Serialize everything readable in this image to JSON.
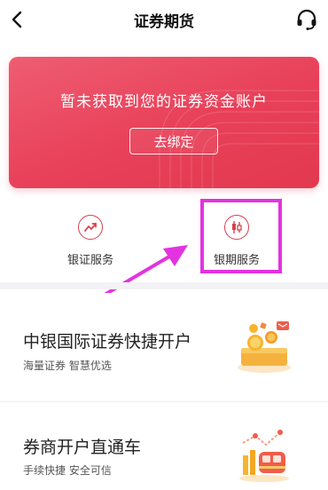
{
  "header": {
    "title": "证券期货",
    "back_icon": "chevron-left-icon",
    "support_icon": "headset-icon"
  },
  "banner": {
    "message": "暂未获取到您的证券资金账户",
    "bind_button": "去绑定",
    "color": "#e84059"
  },
  "services": [
    {
      "label": "银证服务",
      "icon": "trend-chart-icon"
    },
    {
      "label": "银期服务",
      "icon": "candlestick-icon"
    }
  ],
  "promos": [
    {
      "title": "中银国际证券快捷开户",
      "subtitle": "海量证券 智慧优选",
      "icon": "coins-gift-illustration"
    },
    {
      "title": "券商开户直通车",
      "subtitle": "手续快捷 安全可信",
      "icon": "train-chart-illustration"
    }
  ],
  "annotation": {
    "highlight_color": "#e333e0"
  }
}
